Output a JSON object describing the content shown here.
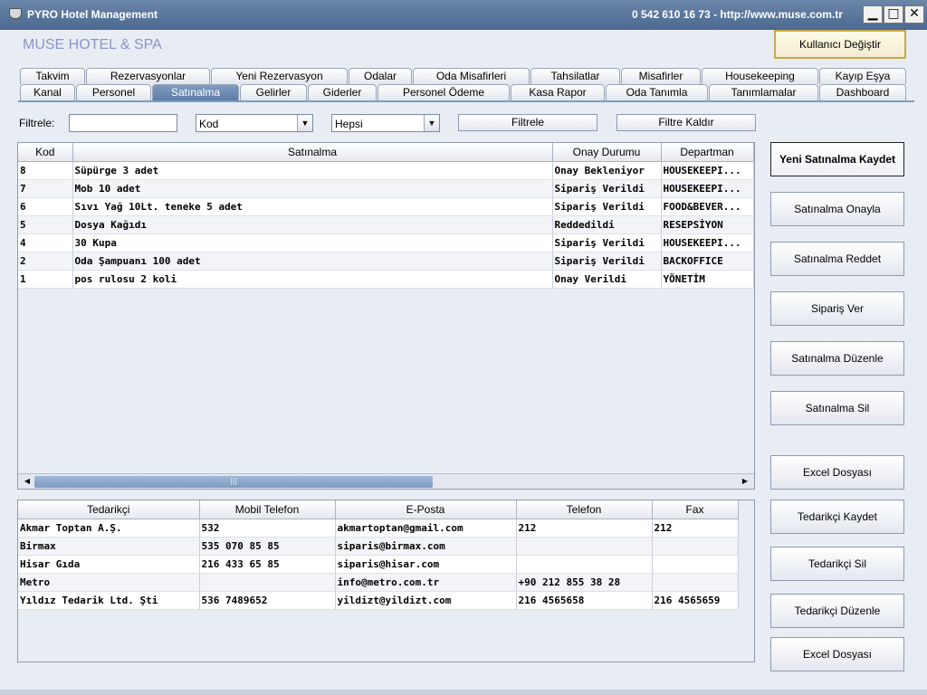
{
  "window": {
    "title": "PYRO Hotel Management",
    "contact": "0 542 610 16 73  -  http://www.muse.com.tr",
    "minimize": "▁",
    "maximize": "□",
    "close": "✕"
  },
  "hotel_name": "MUSE HOTEL & SPA",
  "user_button": "Kullanıcı Değiştir",
  "tabs_row1": [
    "Takvim",
    "Rezervasyonlar",
    "Yeni Rezervasyon",
    "Odalar",
    "Oda Misafirleri",
    "Tahsilatlar",
    "Misafirler",
    "Housekeeping",
    "Kayıp Eşya"
  ],
  "tabs_row2": [
    "Kanal",
    "Personel",
    "Satınalma",
    "Gelirler",
    "Giderler",
    "Personel Ödeme",
    "Kasa Rapor",
    "Oda Tanımla",
    "Tanımlamalar",
    "Dashboard"
  ],
  "active_tab": "Satınalma",
  "filter": {
    "label": "Filtrele:",
    "input_value": "",
    "field_combo": "Kod",
    "status_combo": "Hepsi",
    "apply_button": "Filtrele",
    "clear_button": "Filtre Kaldır"
  },
  "purchases": {
    "columns": [
      "Kod",
      "Satınalma",
      "Onay Durumu",
      "Departman"
    ],
    "rows": [
      [
        "8",
        "Süpürge 3 adet",
        "Onay Bekleniyor",
        "HOUSEKEEPI..."
      ],
      [
        "7",
        "Mob 10 adet",
        "Sipariş Verildi",
        "HOUSEKEEPI..."
      ],
      [
        "6",
        "Sıvı Yağ 10Lt. teneke 5 adet",
        "Sipariş Verildi",
        "FOOD&BEVER..."
      ],
      [
        "5",
        "Dosya Kağıdı",
        "Reddedildi",
        "RESEPSİYON"
      ],
      [
        "4",
        "30 Kupa",
        "Sipariş Verildi",
        "HOUSEKEEPI..."
      ],
      [
        "2",
        "Oda Şampuanı 100 adet",
        "Sipariş Verildi",
        "BACKOFFICE"
      ],
      [
        "1",
        "pos rulosu 2 koli",
        "Onay Verildi",
        "YÖNETİM"
      ]
    ]
  },
  "suppliers": {
    "columns": [
      "Tedarikçi",
      "Mobil Telefon",
      "E-Posta",
      "Telefon",
      "Fax"
    ],
    "rows": [
      [
        "Akmar Toptan A.Ş.",
        "532",
        "akmartoptan@gmail.com",
        "212",
        "212"
      ],
      [
        "Birmax",
        "535 070 85 85",
        "siparis@birmax.com",
        "",
        ""
      ],
      [
        "Hisar Gıda",
        "216 433 65 85",
        "siparis@hisar.com",
        "",
        ""
      ],
      [
        "Metro",
        "",
        "info@metro.com.tr",
        "+90 212 855 38 28",
        ""
      ],
      [
        "Yıldız Tedarik Ltd. Şti",
        "536 7489652",
        "yildizt@yildizt.com",
        "216 4565658",
        "216 4565659"
      ]
    ]
  },
  "actions": {
    "new_purchase": "Yeni Satınalma Kaydet",
    "approve": "Satınalma Onayla",
    "reject": "Satınalma Reddet",
    "order": "Sipariş Ver",
    "edit": "Satınalma Düzenle",
    "delete": "Satınalma Sil",
    "excel1": "Excel Dosyası",
    "supplier_save": "Tedarikçi Kaydet",
    "supplier_delete": "Tedarikçi Sil",
    "supplier_edit": "Tedarikçi Düzenle",
    "excel2": "Excel Dosyası"
  },
  "colors": {
    "titlebar": "#5a7699",
    "active_tab": "#6f8db5",
    "hotel_name": "#8b94c8"
  }
}
